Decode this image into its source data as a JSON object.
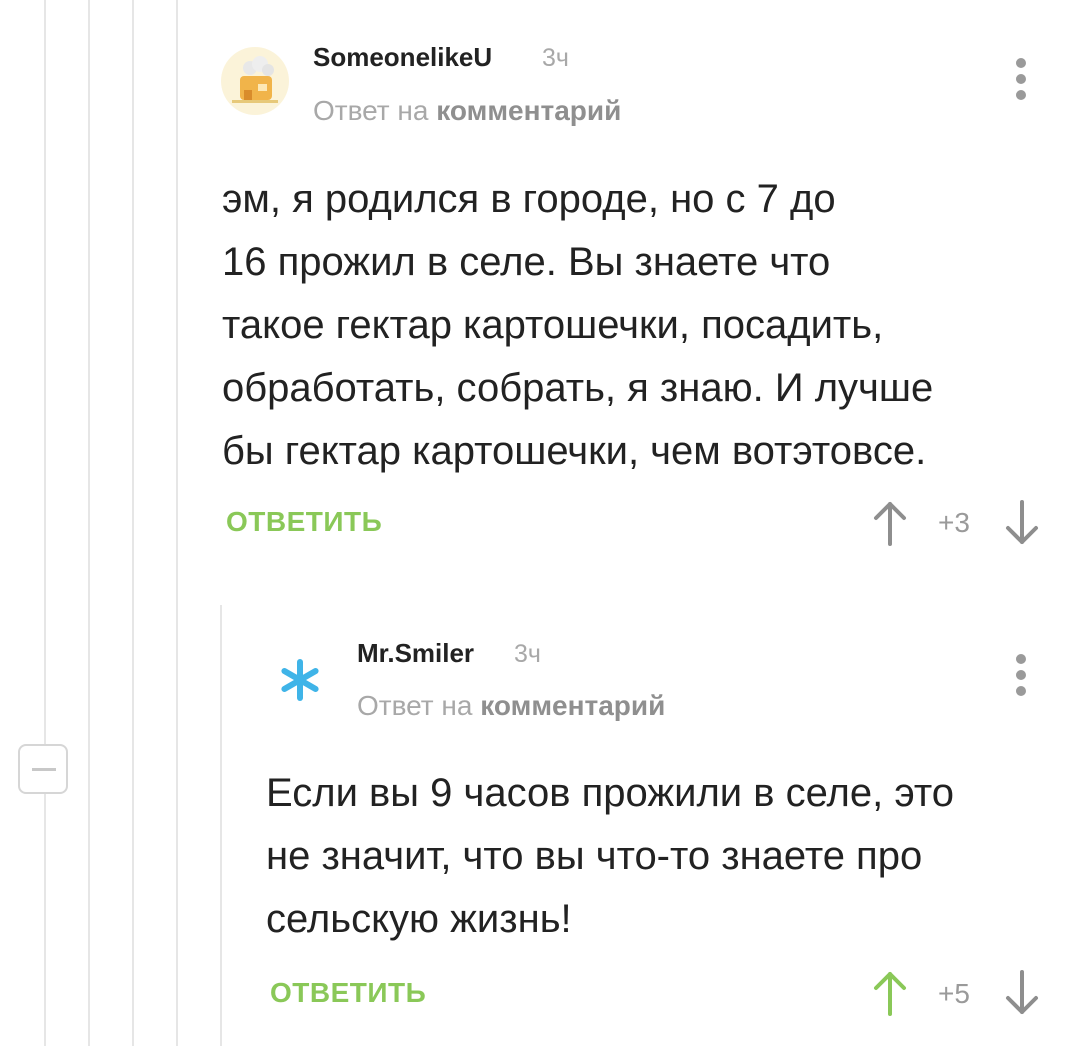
{
  "comments": [
    {
      "username": "SomeonelikeU",
      "time": "3ч",
      "reply_prefix": "Ответ на",
      "reply_link": "комментарий",
      "text_lines": [
        "эм, я родился в городе, но с 7 до",
        "16 прожил в селе. Вы знаете что",
        "такое гектар картошечки, посадить,",
        "обработать, собрать, я знаю. И лучше",
        "бы гектар картошечки, чем вотэтовсе."
      ],
      "reply_label": "ОТВЕТИТЬ",
      "score": "+3"
    },
    {
      "username": "Mr.Smiler",
      "time": "3ч",
      "reply_prefix": "Ответ на",
      "reply_link": "комментарий",
      "text_lines": [
        "Если вы 9 часов прожили в селе, это",
        "не значит, что вы что-то знаете про",
        "сельскую жизнь!"
      ],
      "reply_label": "ОТВЕТИТЬ",
      "score": "+5"
    }
  ],
  "icons": {
    "avatar_1": "bakery-avatar-icon",
    "avatar_2": "asterisk-avatar-icon",
    "more": "more-vertical-icon",
    "upvote": "arrow-up-icon",
    "downvote": "arrow-down-icon",
    "collapse": "collapse-minus-icon"
  },
  "colors": {
    "accent_green": "#8ac858",
    "upvote_active": "#8ac858",
    "asterisk_blue": "#3fb4e8",
    "muted_text": "#a8a8a8"
  }
}
